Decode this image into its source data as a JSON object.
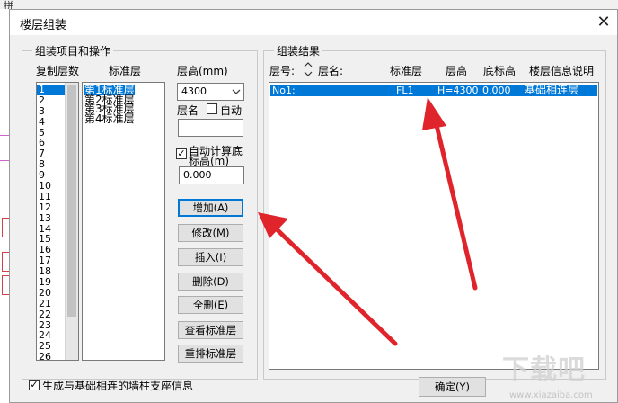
{
  "background": {
    "tab_text": "拼"
  },
  "dialog": {
    "title": "楼层组装",
    "close_glyph": "✕"
  },
  "left_group": {
    "legend": "组装项目和操作",
    "copy_count_label": "复制层数",
    "std_floor_label": "标准层",
    "floor_height_label": "层高(mm)",
    "copy_counts": [
      "1",
      "2",
      "3",
      "4",
      "5",
      "6",
      "7",
      "8",
      "9",
      "10",
      "11",
      "12",
      "13",
      "14",
      "15",
      "16",
      "17",
      "18",
      "19",
      "20",
      "21",
      "22",
      "23",
      "24",
      "25",
      "26"
    ],
    "selected_count": "1",
    "std_floors": [
      "第1标准层",
      "第2标准层",
      "第3标准层",
      "第4标准层"
    ],
    "floor_height_value": "4300",
    "floor_name_label": "层名",
    "auto_label": "自动",
    "floor_name_value": "",
    "auto_calc_label_line1": "自动计算底",
    "auto_calc_label_line2": "标高(m)",
    "auto_calc_checked": "✓",
    "base_elevation_value": "0.000",
    "buttons": {
      "add": "增加(A)",
      "modify": "修改(M)",
      "insert": "插入(I)",
      "delete": "删除(D)",
      "delete_all": "全删(E)",
      "view_std": "查看标准层",
      "reorder_std": "重排标准层"
    }
  },
  "right_group": {
    "legend": "组装结果",
    "headers": {
      "floor_no": "层号:",
      "floor_name": "层名:",
      "std_floor": "标准层",
      "height": "层高",
      "base_elev": "底标高",
      "desc": "楼层信息说明"
    },
    "rows": [
      {
        "no": "No1:",
        "std": "FL1",
        "height": "H=4300",
        "base": "0.000",
        "desc": "基础相连层"
      }
    ]
  },
  "footer": {
    "generate_checkbox_label": "生成与基础相连的墙柱支座信息",
    "generate_checked": "✓",
    "ok_button": "确定(Y)"
  },
  "watermark": {
    "text": "下载吧",
    "url": "www.xiazaiba.com"
  },
  "colors": {
    "selection": "#0078d7",
    "arrow": "#e0242b"
  }
}
